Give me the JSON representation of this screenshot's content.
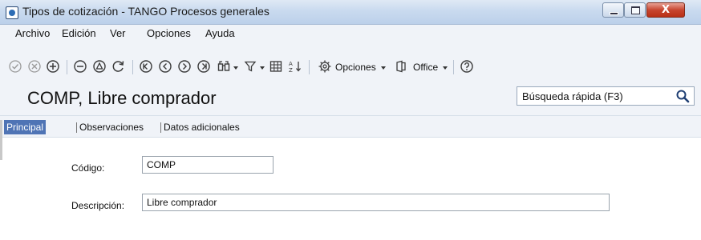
{
  "window": {
    "title": "Tipos de cotización - TANGO Procesos generales",
    "close_glyph": "X"
  },
  "menu": [
    {
      "label": "Archivo"
    },
    {
      "label": "Edición"
    },
    {
      "label": "Ver"
    },
    {
      "label": "Opciones"
    },
    {
      "label": "Ayuda"
    }
  ],
  "toolbar": {
    "opciones_label": "Opciones",
    "office_label": "Office",
    "icons": [
      "check-icon",
      "cancel-icon",
      "add-icon",
      "remove-icon",
      "copy-icon",
      "refresh-icon",
      "first-record-icon",
      "previous-record-icon",
      "next-record-icon",
      "last-record-icon",
      "binoculars-icon",
      "filter-icon",
      "grid-icon",
      "sort-icon",
      "gear-icon",
      "office-icon",
      "help-icon"
    ]
  },
  "header": {
    "title": "COMP, Libre comprador",
    "search_placeholder": "Búsqueda rápida (F3)"
  },
  "tabs": [
    {
      "label": "Principal",
      "active": true
    },
    {
      "label": "Observaciones",
      "active": false
    },
    {
      "label": "Datos adicionales",
      "active": false
    }
  ],
  "form": {
    "codigo_label": "Código:",
    "codigo_value": "COMP",
    "descripcion_label": "Descripción:",
    "descripcion_value": "Libre comprador"
  },
  "colors": {
    "active_tab": "#4f74b5",
    "close_button": "#c7452f"
  }
}
